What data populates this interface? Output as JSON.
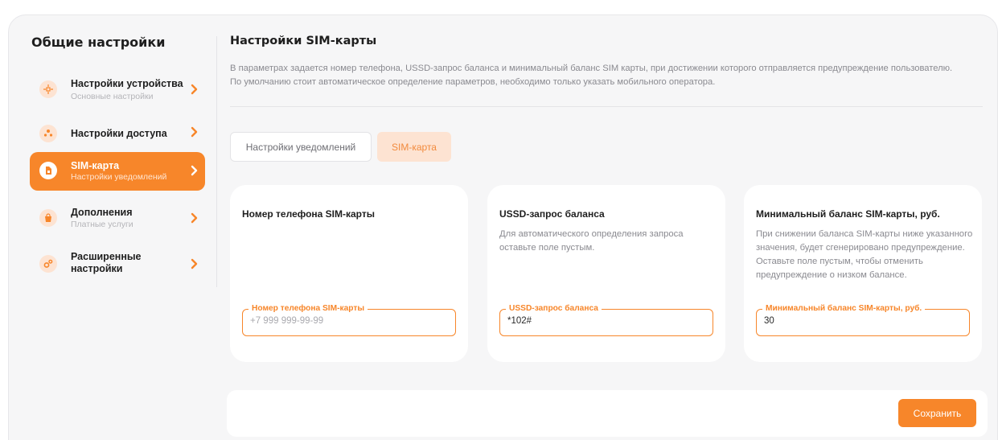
{
  "sidebar": {
    "title": "Общие настройки",
    "items": [
      {
        "title": "Настройки устройства",
        "sub": "Основные настройки",
        "icon": "device-settings-icon",
        "active": false
      },
      {
        "title": "Настройки доступа",
        "sub": "",
        "icon": "access-users-icon",
        "active": false
      },
      {
        "title": "SIM-карта",
        "sub": "Настройки уведомлений",
        "icon": "sim-card-icon",
        "active": true
      },
      {
        "title": "Дополнения",
        "sub": "Платные услуги",
        "icon": "shopping-bag-icon",
        "active": false
      },
      {
        "title": "Расширенные",
        "title2": "настройки",
        "sub": "",
        "icon": "gears-icon",
        "active": false
      }
    ]
  },
  "main": {
    "title": "Настройки SIM-карты",
    "description_line1": "В параметрах задается номер телефона, USSD-запрос баланса и минимальный баланс SIM карты, при достижении которого отправляется предупреждение пользователю.",
    "description_line2": "По умолчанию стоит автоматическое определение параметров, необходимо только указать мобильного оператора.",
    "tabs": [
      {
        "label": "Настройки уведомлений",
        "active": false
      },
      {
        "label": "SIM-карта",
        "active": true
      }
    ],
    "cards": [
      {
        "title": "Номер телефона SIM-карты",
        "description": "",
        "field_label": "Номер телефона SIM-карты",
        "value": "",
        "placeholder": "+7 999 999-99-99"
      },
      {
        "title": "USSD-запрос баланса",
        "description": "Для автоматического определения запроса оставьте поле пустым.",
        "field_label": "USSD-запрос баланса",
        "value": "*102#",
        "placeholder": ""
      },
      {
        "title": "Минимальный баланс SIM-карты, руб.",
        "description": "При снижении баланса SIM-карты ниже указанного значения, будет сгенерировано предупреждение. Оставьте поле пустым, чтобы отменить предупреждение о низком балансе.",
        "field_label": "Минимальный баланс SIM-карты, руб.",
        "value": "30",
        "placeholder": ""
      }
    ],
    "save_label": "Сохранить"
  },
  "colors": {
    "accent": "#f7862a",
    "accent_soft": "#fde3d2",
    "background": "#f6f6f7"
  }
}
